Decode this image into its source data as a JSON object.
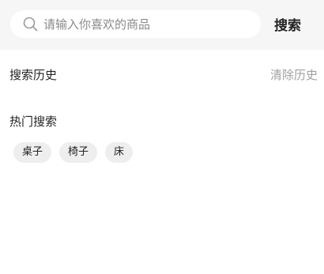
{
  "search": {
    "placeholder": "请输入你喜欢的商品",
    "value": "",
    "button_label": "搜索",
    "icon": "search-icon"
  },
  "history": {
    "title": "搜索历史",
    "clear_label": "清除历史",
    "items": []
  },
  "hot": {
    "title": "热门搜索",
    "tags": [
      "桌子",
      "椅子",
      "床"
    ]
  }
}
